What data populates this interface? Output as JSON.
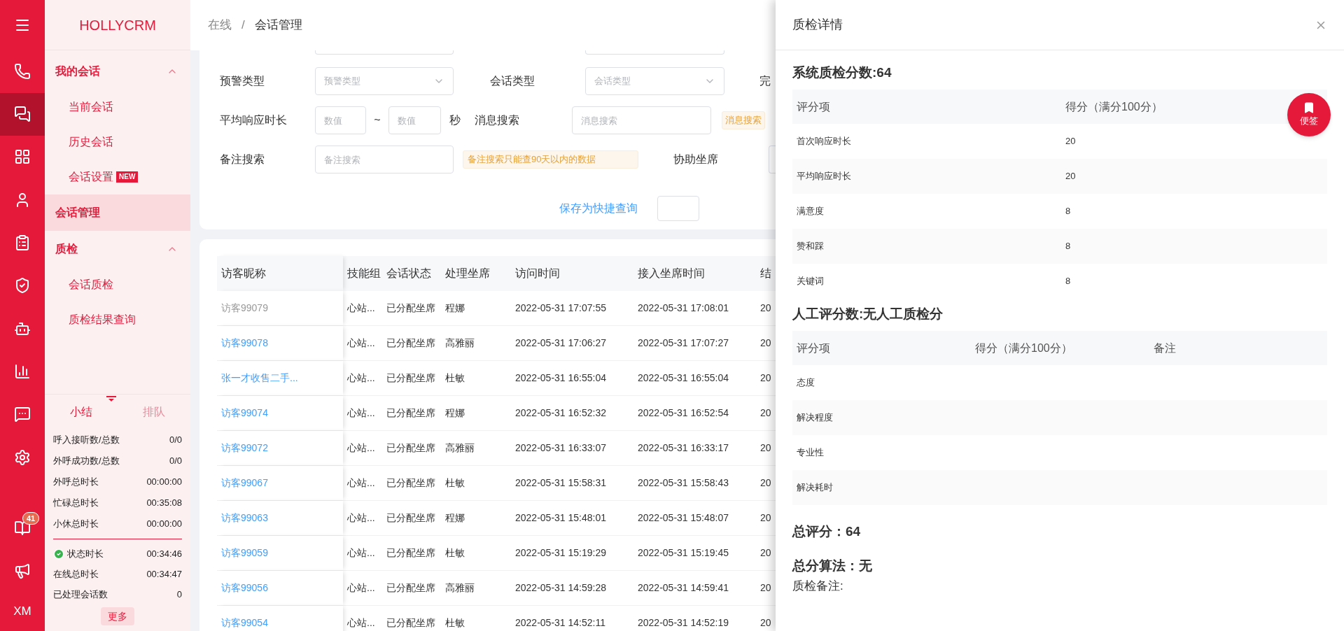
{
  "rail": {
    "items": [
      {
        "selected": false
      },
      {
        "selected": true
      },
      {
        "selected": false
      },
      {
        "selected": false
      },
      {
        "selected": false
      },
      {
        "selected": false
      },
      {
        "selected": false
      },
      {
        "selected": false
      },
      {
        "selected": false
      },
      {
        "selected": false
      },
      {
        "selected": false,
        "badge": "41"
      },
      {
        "selected": false
      }
    ],
    "initials": "XM"
  },
  "sidebar": {
    "logo": "HOLLYCRM",
    "nav": [
      {
        "label": "我的会话",
        "expanded": true,
        "selected": false,
        "children": [
          {
            "label": "当前会话",
            "selected": false
          },
          {
            "label": "历史会话",
            "selected": false
          },
          {
            "label": "会话设置",
            "selected": false,
            "badge": "NEW"
          }
        ]
      },
      {
        "label": "会话管理",
        "selected": true
      },
      {
        "label": "质检",
        "expanded": true,
        "selected": false,
        "children": [
          {
            "label": "会话质检",
            "selected": false
          },
          {
            "label": "质检结果查询",
            "selected": false
          }
        ]
      }
    ],
    "summary_tabs": [
      {
        "label": "小结",
        "selected": true
      },
      {
        "label": "排队",
        "selected": false
      }
    ],
    "stats": [
      {
        "label": "呼入接听数/总数",
        "value": "0/0"
      },
      {
        "label": "外呼成功数/总数",
        "value": "0/0"
      },
      {
        "label": "外呼总时长",
        "value": "00:00:00"
      },
      {
        "label": "忙碌总时长",
        "value": "00:35:08"
      },
      {
        "label": "小休总时长",
        "value": "00:00:00"
      }
    ],
    "status_stats": [
      {
        "label": "状态时长",
        "value": "00:34:46",
        "kind": "status"
      },
      {
        "label": "在线总时长",
        "value": "00:34:47",
        "kind": "plain"
      },
      {
        "label": "已处理会话数",
        "value": "0",
        "kind": "plain"
      }
    ],
    "more_button": "更多"
  },
  "breadcrumb": {
    "items": [
      "在线",
      "会话管理"
    ],
    "separator": "/"
  },
  "filters": {
    "row1": {
      "label1": "预警类型",
      "select1": "预警类型",
      "label2": "会话类型",
      "select2": "会话类型",
      "label3": "完"
    },
    "row2": {
      "label1": "平均响应时长",
      "min": {
        "placeholder": "数值"
      },
      "sep": "~",
      "max": {
        "placeholder": "数值"
      },
      "unit": "秒",
      "label2": "消息搜索",
      "input2": {
        "placeholder": "消息搜索"
      },
      "tag": "消息搜索"
    },
    "row3": {
      "label1": "备注搜索",
      "input1": {
        "placeholder": "备注搜索"
      },
      "tag": "备注搜索只能查90天以内的数据",
      "label2": "协助坐席"
    },
    "save_link": "保存为快捷查询"
  },
  "table": {
    "columns": [
      "访客昵称",
      "技能组",
      "会话状态",
      "处理坐席",
      "访问时间",
      "接入坐席时间",
      "结"
    ],
    "rows": [
      {
        "muted": true,
        "cells": [
          "访客99079",
          "心站...",
          "已分配坐席",
          "程娜",
          "2022-05-31 17:07:55",
          "2022-05-31 17:08:01",
          "20"
        ]
      },
      {
        "muted": false,
        "cells": [
          "访客99078",
          "心站...",
          "已分配坐席",
          "高雅丽",
          "2022-05-31 17:06:27",
          "2022-05-31 17:07:27",
          "20"
        ]
      },
      {
        "muted": false,
        "cells": [
          "张一才收售二手...",
          "心站...",
          "已分配坐席",
          "杜敏",
          "2022-05-31 16:55:04",
          "2022-05-31 16:55:04",
          "20"
        ]
      },
      {
        "muted": false,
        "cells": [
          "访客99074",
          "心站...",
          "已分配坐席",
          "程娜",
          "2022-05-31 16:52:32",
          "2022-05-31 16:52:54",
          "20"
        ]
      },
      {
        "muted": false,
        "cells": [
          "访客99072",
          "心站...",
          "已分配坐席",
          "高雅丽",
          "2022-05-31 16:33:07",
          "2022-05-31 16:33:17",
          "20"
        ]
      },
      {
        "muted": false,
        "cells": [
          "访客99067",
          "心站...",
          "已分配坐席",
          "杜敏",
          "2022-05-31 15:58:31",
          "2022-05-31 15:58:43",
          "20"
        ]
      },
      {
        "muted": false,
        "cells": [
          "访客99063",
          "心站...",
          "已分配坐席",
          "程娜",
          "2022-05-31 15:48:01",
          "2022-05-31 15:48:07",
          "20"
        ]
      },
      {
        "muted": false,
        "cells": [
          "访客99059",
          "心站...",
          "已分配坐席",
          "杜敏",
          "2022-05-31 15:19:29",
          "2022-05-31 15:19:45",
          "20"
        ]
      },
      {
        "muted": false,
        "cells": [
          "访客99056",
          "心站...",
          "已分配坐席",
          "高雅丽",
          "2022-05-31 14:59:28",
          "2022-05-31 14:59:41",
          "20"
        ]
      },
      {
        "muted": false,
        "cells": [
          "访客99054",
          "心站...",
          "已分配坐席",
          "杜敏",
          "2022-05-31 14:52:11",
          "2022-05-31 14:52:19",
          "20"
        ]
      }
    ]
  },
  "drawer": {
    "title": "质检详情",
    "system": {
      "title": "系统质检分数:64",
      "columns": [
        "评分项",
        "得分（满分100分）"
      ],
      "rows": [
        [
          "首次响应时长",
          "20"
        ],
        [
          "平均响应时长",
          "20"
        ],
        [
          "满意度",
          "8"
        ],
        [
          "赞和踩",
          "8"
        ],
        [
          "关键词",
          "8"
        ]
      ]
    },
    "manual": {
      "title": "人工评分数:无人工质检分",
      "columns": [
        "评分项",
        "得分（满分100分）",
        "备注"
      ],
      "rows": [
        [
          "态度"
        ],
        [
          "解决程度"
        ],
        [
          "专业性"
        ],
        [
          "解决耗时"
        ]
      ]
    },
    "total": "总评分：64",
    "algorithm": "总分算法：无",
    "remark": "质检备注:"
  },
  "note_button": "便签"
}
